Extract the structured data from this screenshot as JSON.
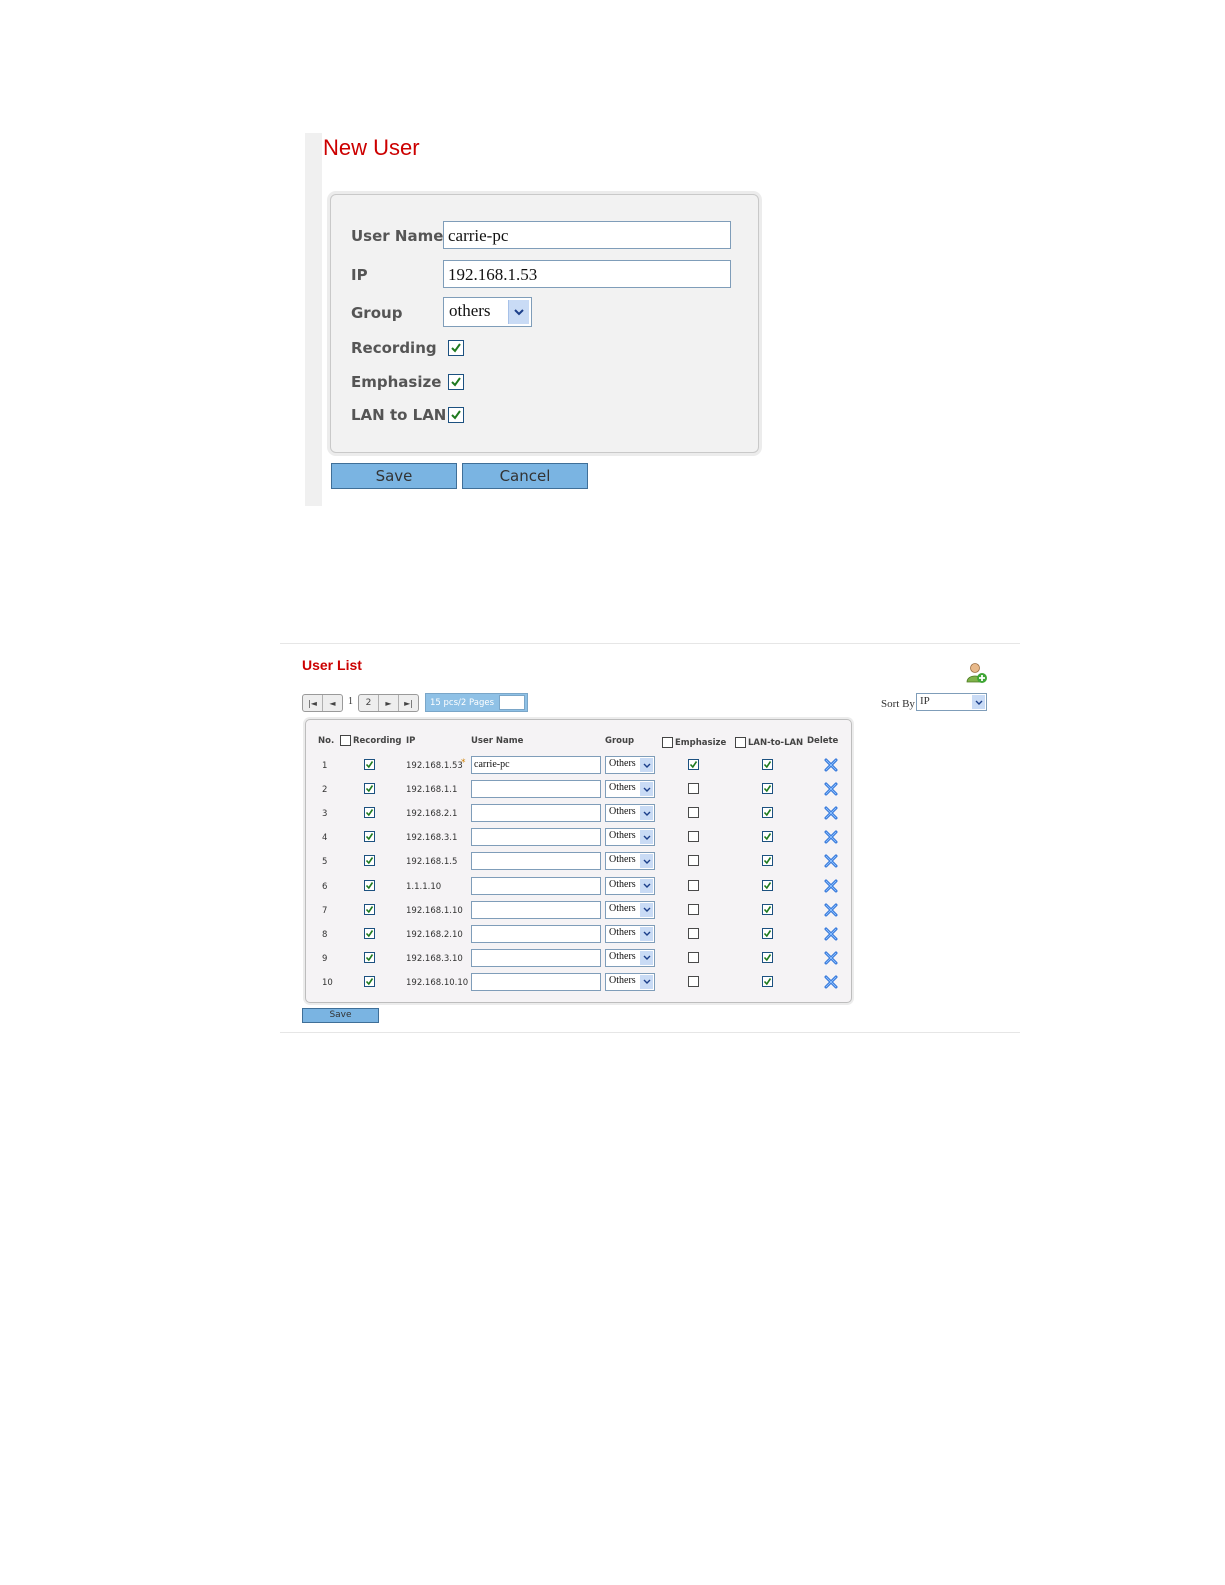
{
  "new_user": {
    "title": "New User",
    "labels": {
      "user_name": "User Name",
      "ip": "IP",
      "group": "Group",
      "recording": "Recording",
      "emphasize": "Emphasize",
      "lan_to_lan": "LAN to LAN"
    },
    "values": {
      "user_name": "carrie-pc",
      "ip": "192.168.1.53",
      "group": "others",
      "recording": true,
      "emphasize": true,
      "lan_to_lan": true
    },
    "buttons": {
      "save": "Save",
      "cancel": "Cancel"
    }
  },
  "user_list": {
    "title": "User List",
    "pager": {
      "current_page": "1",
      "next_page": "2",
      "summary": "15 pcs/2 Pages"
    },
    "sort_by": {
      "label": "Sort By",
      "value": "IP"
    },
    "columns": {
      "no": "No.",
      "recording": "Recording",
      "ip": "IP",
      "user_name": "User Name",
      "group": "Group",
      "emphasize": "Emphasize",
      "lan_to_lan": "LAN-to-LAN",
      "delete": "Delete"
    },
    "rows": [
      {
        "no": "1",
        "recording": true,
        "ip": "192.168.1.53",
        "current": "*",
        "user_name": "carrie-pc",
        "group": "Others",
        "emphasize": true,
        "lan_to_lan": true
      },
      {
        "no": "2",
        "recording": true,
        "ip": "192.168.1.1",
        "user_name": "",
        "group": "Others",
        "emphasize": false,
        "lan_to_lan": true
      },
      {
        "no": "3",
        "recording": true,
        "ip": "192.168.2.1",
        "user_name": "",
        "group": "Others",
        "emphasize": false,
        "lan_to_lan": true
      },
      {
        "no": "4",
        "recording": true,
        "ip": "192.168.3.1",
        "user_name": "",
        "group": "Others",
        "emphasize": false,
        "lan_to_lan": true
      },
      {
        "no": "5",
        "recording": true,
        "ip": "192.168.1.5",
        "user_name": "",
        "group": "Others",
        "emphasize": false,
        "lan_to_lan": true
      },
      {
        "no": "6",
        "recording": true,
        "ip": "1.1.1.10",
        "user_name": "",
        "group": "Others",
        "emphasize": false,
        "lan_to_lan": true
      },
      {
        "no": "7",
        "recording": true,
        "ip": "192.168.1.10",
        "user_name": "",
        "group": "Others",
        "emphasize": false,
        "lan_to_lan": true
      },
      {
        "no": "8",
        "recording": true,
        "ip": "192.168.2.10",
        "user_name": "",
        "group": "Others",
        "emphasize": false,
        "lan_to_lan": true
      },
      {
        "no": "9",
        "recording": true,
        "ip": "192.168.3.10",
        "user_name": "",
        "group": "Others",
        "emphasize": false,
        "lan_to_lan": true
      },
      {
        "no": "10",
        "recording": true,
        "ip": "192.168.10.10",
        "user_name": "",
        "group": "Others",
        "emphasize": false,
        "lan_to_lan": true
      }
    ],
    "save_label": "Save"
  },
  "icons": {
    "check": "check-icon",
    "delete": "delete-x-icon",
    "add_user": "add-user-icon",
    "dropdown": "chevron-down-icon"
  },
  "colors": {
    "title_red": "#cc0000",
    "button_blue": "#7ab4e2",
    "check_green": "#1f7a1f",
    "delete_blue": "#2a6fd6"
  }
}
